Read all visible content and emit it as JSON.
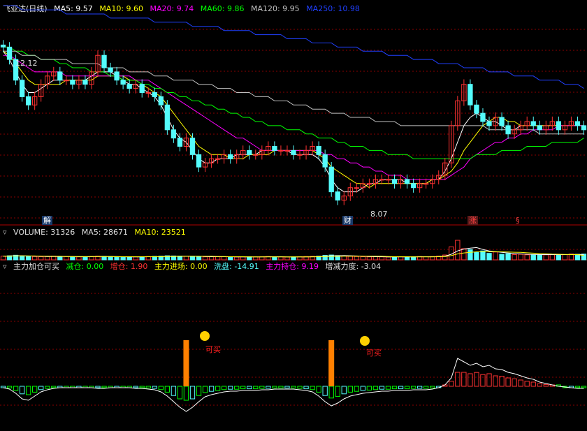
{
  "price_header": {
    "title": "飞亚达(日线)",
    "ma5": "MA5: 9.57",
    "ma10": "MA10: 9.60",
    "ma20": "MA20: 9.74",
    "ma60": "MA60: 9.86",
    "ma120": "MA120: 9.95",
    "ma250": "MA250: 10.98"
  },
  "volume_header": {
    "volume": "VOLUME: 31326",
    "ma5": "MA5: 28671",
    "ma10": "MA10: 23521"
  },
  "indicator_header": {
    "name": "主力加仓可买",
    "reduce": "减仓: 0.00",
    "increase": "增仓: 1.90",
    "main_in": "主力进场: 0.00",
    "wash": "洗盘: -14.91",
    "hold": "主力持仓: 9.19",
    "strength": "增减力度: -3.04"
  },
  "annotations": {
    "high_label": "12.12",
    "low_label": "8.07",
    "buy_label_1": "可买",
    "buy_label_2": "可买",
    "marker_jie": "解",
    "marker_cai": "财",
    "marker_zhang": "涨",
    "marker_s": "§"
  },
  "colors": {
    "up": "#ff3232",
    "down": "#54fcfc",
    "ma5": "#ffffff",
    "ma10": "#ffff00",
    "ma20": "#ff00ff",
    "ma60": "#00ff00",
    "ma120": "#c0c0c0",
    "ma250": "#2040ff",
    "buy_bar": "#ff8000",
    "grid": "#8a0000"
  },
  "chart_data": [
    {
      "type": "candlestick",
      "title": "飞亚达(日线)",
      "ylim": [
        7.8,
        12.9
      ],
      "high": 12.12,
      "low": 8.07,
      "closes": [
        12.1,
        11.8,
        11.3,
        10.9,
        10.7,
        10.9,
        11.2,
        11.4,
        11.5,
        11.3,
        11.3,
        11.2,
        11.3,
        11.2,
        11.5,
        11.9,
        11.6,
        11.5,
        11.3,
        11.2,
        11.1,
        11.2,
        11.0,
        11.0,
        10.9,
        10.7,
        10.1,
        9.9,
        9.7,
        9.9,
        9.5,
        9.2,
        9.3,
        9.4,
        9.4,
        9.5,
        9.4,
        9.5,
        9.6,
        9.5,
        9.5,
        9.6,
        9.7,
        9.6,
        9.6,
        9.6,
        9.5,
        9.5,
        9.6,
        9.7,
        9.5,
        9.2,
        8.6,
        8.4,
        8.5,
        8.7,
        8.7,
        8.8,
        8.8,
        8.9,
        8.9,
        8.9,
        8.8,
        8.9,
        8.8,
        8.7,
        8.8,
        8.8,
        8.9,
        9.0,
        9.3,
        10.2,
        10.8,
        11.2,
        10.7,
        10.5,
        10.3,
        10.2,
        10.4,
        10.2,
        10.0,
        10.1,
        10.2,
        10.3,
        10.2,
        10.1,
        10.2,
        10.3,
        10.1,
        10.2,
        10.3,
        10.2,
        10.1
      ],
      "series": [
        {
          "name": "MA5",
          "values": [
            12.0,
            11.8,
            11.5,
            11.2,
            11.0,
            11.0,
            11.1,
            11.2,
            11.3,
            11.3,
            11.3,
            11.3,
            11.3,
            11.3,
            11.4,
            11.5,
            11.5,
            11.5,
            11.4,
            11.3,
            11.2,
            11.2,
            11.1,
            11.0,
            10.9,
            10.7,
            10.4,
            10.1,
            9.9,
            9.8,
            9.6,
            9.4,
            9.3,
            9.3,
            9.4,
            9.4,
            9.4,
            9.5,
            9.5,
            9.5,
            9.5,
            9.6,
            9.6,
            9.6,
            9.6,
            9.6,
            9.5,
            9.5,
            9.5,
            9.5,
            9.4,
            9.2,
            8.9,
            8.7,
            8.6,
            8.6,
            8.6,
            8.7,
            8.8,
            8.8,
            8.9,
            8.9,
            8.9,
            8.9,
            8.8,
            8.8,
            8.8,
            8.8,
            8.9,
            8.9,
            9.1,
            9.4,
            9.8,
            10.2,
            10.4,
            10.5,
            10.4,
            10.3,
            10.3,
            10.2,
            10.1,
            10.1,
            10.2,
            10.2,
            10.2,
            10.2,
            10.2,
            10.2,
            10.2,
            10.2,
            10.2,
            10.2,
            10.2
          ]
        },
        {
          "name": "MA10",
          "values": [
            12.0,
            11.9,
            11.7,
            11.5,
            11.3,
            11.2,
            11.2,
            11.2,
            11.2,
            11.2,
            11.3,
            11.3,
            11.3,
            11.3,
            11.3,
            11.4,
            11.4,
            11.4,
            11.4,
            11.4,
            11.3,
            11.3,
            11.2,
            11.1,
            11.0,
            10.9,
            10.7,
            10.5,
            10.3,
            10.1,
            9.9,
            9.7,
            9.6,
            9.5,
            9.5,
            9.5,
            9.4,
            9.4,
            9.4,
            9.5,
            9.5,
            9.5,
            9.5,
            9.6,
            9.6,
            9.6,
            9.6,
            9.6,
            9.6,
            9.6,
            9.5,
            9.4,
            9.2,
            9.1,
            9.0,
            8.9,
            8.8,
            8.8,
            8.7,
            8.8,
            8.8,
            8.8,
            8.8,
            8.8,
            8.8,
            8.8,
            8.8,
            8.8,
            8.9,
            8.9,
            9.0,
            9.1,
            9.3,
            9.6,
            9.8,
            10.0,
            10.2,
            10.3,
            10.4,
            10.4,
            10.3,
            10.3,
            10.2,
            10.2,
            10.2,
            10.2,
            10.2,
            10.2,
            10.2,
            10.2,
            10.2,
            10.2,
            10.2
          ]
        },
        {
          "name": "MA20",
          "values": [
            11.9,
            11.9,
            11.8,
            11.7,
            11.6,
            11.5,
            11.5,
            11.5,
            11.5,
            11.5,
            11.4,
            11.4,
            11.4,
            11.4,
            11.4,
            11.4,
            11.4,
            11.4,
            11.4,
            11.4,
            11.4,
            11.3,
            11.3,
            11.3,
            11.2,
            11.1,
            11.0,
            10.9,
            10.8,
            10.7,
            10.6,
            10.5,
            10.4,
            10.3,
            10.2,
            10.1,
            10.0,
            9.9,
            9.9,
            9.8,
            9.7,
            9.6,
            9.6,
            9.6,
            9.6,
            9.6,
            9.6,
            9.6,
            9.6,
            9.6,
            9.6,
            9.5,
            9.5,
            9.4,
            9.4,
            9.3,
            9.3,
            9.2,
            9.2,
            9.1,
            9.1,
            9.0,
            9.0,
            9.0,
            8.9,
            8.9,
            8.9,
            8.9,
            8.9,
            8.9,
            8.9,
            9.0,
            9.1,
            9.2,
            9.4,
            9.5,
            9.6,
            9.7,
            9.8,
            9.8,
            9.9,
            9.9,
            10.0,
            10.0,
            10.1,
            10.1,
            10.1,
            10.1,
            10.2,
            10.2,
            10.2,
            10.2,
            10.2
          ]
        },
        {
          "name": "MA60",
          "values": [
            12.1,
            12.1,
            12.0,
            12.0,
            11.9,
            11.9,
            11.8,
            11.8,
            11.8,
            11.7,
            11.7,
            11.6,
            11.6,
            11.6,
            11.5,
            11.5,
            11.5,
            11.4,
            11.4,
            11.3,
            11.3,
            11.3,
            11.2,
            11.2,
            11.1,
            11.1,
            11.0,
            11.0,
            10.9,
            10.9,
            10.8,
            10.8,
            10.7,
            10.7,
            10.6,
            10.6,
            10.5,
            10.5,
            10.4,
            10.4,
            10.3,
            10.3,
            10.2,
            10.2,
            10.2,
            10.1,
            10.1,
            10.1,
            10.0,
            10.0,
            9.9,
            9.9,
            9.9,
            9.8,
            9.8,
            9.7,
            9.7,
            9.7,
            9.6,
            9.6,
            9.6,
            9.5,
            9.5,
            9.5,
            9.5,
            9.4,
            9.4,
            9.4,
            9.4,
            9.4,
            9.4,
            9.4,
            9.4,
            9.4,
            9.4,
            9.5,
            9.5,
            9.5,
            9.5,
            9.6,
            9.6,
            9.6,
            9.6,
            9.7,
            9.7,
            9.7,
            9.7,
            9.8,
            9.8,
            9.8,
            9.8,
            9.8,
            9.9
          ]
        },
        {
          "name": "MA120",
          "values": [
            12.0,
            12.0,
            12.0,
            11.9,
            11.9,
            11.9,
            11.8,
            11.8,
            11.8,
            11.8,
            11.8,
            11.7,
            11.7,
            11.7,
            11.7,
            11.7,
            11.6,
            11.6,
            11.6,
            11.6,
            11.5,
            11.5,
            11.5,
            11.5,
            11.4,
            11.4,
            11.4,
            11.3,
            11.3,
            11.3,
            11.3,
            11.2,
            11.2,
            11.2,
            11.1,
            11.1,
            11.1,
            11.0,
            11.0,
            11.0,
            10.9,
            10.9,
            10.9,
            10.8,
            10.8,
            10.8,
            10.7,
            10.7,
            10.7,
            10.6,
            10.6,
            10.6,
            10.5,
            10.5,
            10.5,
            10.4,
            10.4,
            10.4,
            10.4,
            10.3,
            10.3,
            10.3,
            10.3,
            10.2,
            10.2,
            10.2,
            10.2,
            10.2,
            10.2,
            10.2,
            10.2,
            10.2,
            10.2,
            10.2,
            10.2,
            10.2,
            10.2,
            10.1,
            10.1,
            10.1,
            10.1,
            10.1,
            10.1,
            10.1,
            10.1,
            10.0,
            10.0,
            10.0,
            10.0,
            10.0,
            10.0,
            10.0,
            10.0
          ]
        },
        {
          "name": "MA250",
          "values": [
            13.1,
            13.1,
            13.1,
            13.0,
            13.0,
            13.0,
            13.0,
            13.0,
            13.0,
            13.0,
            12.9,
            12.9,
            12.9,
            12.9,
            12.9,
            12.9,
            12.9,
            12.8,
            12.8,
            12.8,
            12.8,
            12.8,
            12.8,
            12.8,
            12.7,
            12.7,
            12.7,
            12.7,
            12.7,
            12.7,
            12.6,
            12.6,
            12.6,
            12.6,
            12.6,
            12.5,
            12.5,
            12.5,
            12.5,
            12.5,
            12.4,
            12.4,
            12.4,
            12.4,
            12.4,
            12.3,
            12.3,
            12.3,
            12.3,
            12.2,
            12.2,
            12.2,
            12.2,
            12.1,
            12.1,
            12.1,
            12.1,
            12.0,
            12.0,
            12.0,
            12.0,
            11.9,
            11.9,
            11.9,
            11.9,
            11.8,
            11.8,
            11.8,
            11.8,
            11.7,
            11.7,
            11.7,
            11.7,
            11.6,
            11.6,
            11.6,
            11.6,
            11.5,
            11.5,
            11.5,
            11.5,
            11.4,
            11.4,
            11.4,
            11.4,
            11.3,
            11.3,
            11.3,
            11.3,
            11.2,
            11.2,
            11.2,
            11.1
          ]
        }
      ]
    },
    {
      "type": "bar",
      "title": "VOLUME",
      "ylim": [
        0,
        120000
      ],
      "values": [
        20000,
        22000,
        25000,
        21000,
        19000,
        18000,
        17000,
        18000,
        20000,
        19000,
        18000,
        17000,
        16000,
        17000,
        18000,
        20000,
        19000,
        18000,
        17000,
        16000,
        15000,
        16000,
        17000,
        18000,
        19000,
        20000,
        22000,
        21000,
        20000,
        19000,
        18000,
        17000,
        16000,
        17000,
        18000,
        17000,
        16000,
        15000,
        16000,
        17000,
        16000,
        17000,
        18000,
        17000,
        16000,
        15000,
        16000,
        17000,
        18000,
        19000,
        20000,
        24000,
        26000,
        23000,
        21000,
        19000,
        18000,
        17000,
        16000,
        17000,
        16000,
        15000,
        16000,
        17000,
        16000,
        17000,
        18000,
        17000,
        18000,
        20000,
        26000,
        70000,
        105000,
        60000,
        55000,
        40000,
        48000,
        35000,
        42000,
        30000,
        33000,
        28000,
        30000,
        27000,
        26000,
        28000,
        27000,
        30000,
        29000,
        28000,
        31000,
        30000,
        31326
      ],
      "series": [
        {
          "name": "MA5",
          "values": [
            20000,
            21000,
            22000,
            22000,
            21000,
            20000,
            19000,
            18000,
            18000,
            18000,
            18000,
            18000,
            17000,
            17000,
            17000,
            18000,
            18000,
            18000,
            18000,
            17000,
            16000,
            16000,
            16000,
            17000,
            17000,
            18000,
            19000,
            20000,
            20000,
            20000,
            20000,
            19000,
            18000,
            17000,
            17000,
            17000,
            17000,
            16000,
            16000,
            16000,
            16000,
            16000,
            17000,
            17000,
            17000,
            16000,
            16000,
            16000,
            16000,
            17000,
            18000,
            20000,
            22000,
            22000,
            23000,
            22000,
            21000,
            19000,
            18000,
            17000,
            17000,
            16000,
            16000,
            16000,
            16000,
            16000,
            17000,
            17000,
            17000,
            18000,
            20000,
            30000,
            48000,
            58000,
            63000,
            66000,
            56000,
            48000,
            44000,
            40000,
            37000,
            34000,
            32000,
            30000,
            29000,
            28000,
            28000,
            28000,
            28000,
            28000,
            29000,
            29000,
            28671
          ]
        },
        {
          "name": "MA10",
          "values": [
            20000,
            20000,
            21000,
            21000,
            21000,
            21000,
            20000,
            20000,
            19000,
            19000,
            18000,
            18000,
            18000,
            18000,
            18000,
            18000,
            18000,
            18000,
            17000,
            17000,
            17000,
            17000,
            17000,
            17000,
            17000,
            17000,
            18000,
            18000,
            19000,
            19000,
            19000,
            19000,
            19000,
            19000,
            18000,
            18000,
            17000,
            17000,
            17000,
            16000,
            16000,
            16000,
            16000,
            16000,
            16000,
            16000,
            16000,
            16000,
            16000,
            16000,
            17000,
            18000,
            19000,
            19000,
            20000,
            20000,
            20000,
            20000,
            20000,
            20000,
            19000,
            18000,
            17000,
            17000,
            17000,
            16000,
            16000,
            16000,
            16000,
            17000,
            18000,
            23000,
            32000,
            37000,
            40000,
            43000,
            43000,
            43000,
            44000,
            43000,
            42000,
            41000,
            40000,
            38000,
            36000,
            34000,
            33000,
            31000,
            30000,
            29000,
            28000,
            28000,
            23521
          ]
        }
      ]
    },
    {
      "type": "line",
      "title": "主力加仓可买",
      "ylim": [
        -60,
        60
      ],
      "strength": [
        -2,
        -4,
        -10,
        -18,
        -20,
        -14,
        -8,
        -5,
        -3,
        -2,
        -2,
        -2,
        -2,
        -2,
        -2,
        -3,
        -3,
        -2,
        -2,
        -2,
        -2,
        -3,
        -3,
        -4,
        -5,
        -8,
        -14,
        -22,
        -30,
        -36,
        -30,
        -22,
        -15,
        -12,
        -10,
        -8,
        -7,
        -7,
        -6,
        -6,
        -6,
        -5,
        -5,
        -4,
        -4,
        -4,
        -4,
        -5,
        -6,
        -8,
        -14,
        -22,
        -28,
        -24,
        -18,
        -14,
        -12,
        -10,
        -9,
        -8,
        -7,
        -7,
        -6,
        -6,
        -6,
        -5,
        -5,
        -5,
        -4,
        -2,
        2,
        12,
        40,
        35,
        30,
        33,
        28,
        30,
        25,
        24,
        20,
        18,
        15,
        12,
        10,
        6,
        4,
        2,
        0,
        -1,
        -2,
        -3,
        -3.04
      ],
      "buy_signals": [
        {
          "index": 29,
          "label": "可买"
        },
        {
          "index": 52,
          "label": "可买"
        }
      ]
    }
  ]
}
